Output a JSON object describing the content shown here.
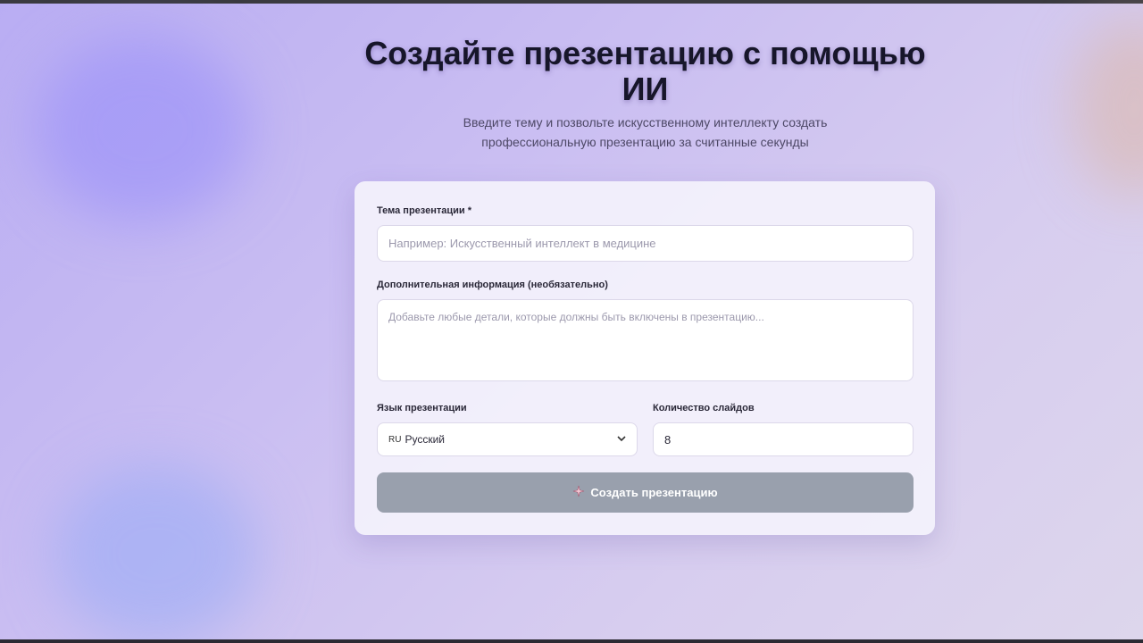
{
  "header": {
    "title": "Создайте презентацию с помощью ИИ",
    "subtitle": "Введите тему и позвольте искусственному интеллекту создать профессиональную презентацию за считанные секунды"
  },
  "form": {
    "topic": {
      "label": "Тема презентации *",
      "placeholder": "Например: Искусственный интеллект в медицине",
      "value": ""
    },
    "details": {
      "label": "Дополнительная информация (необязательно)",
      "placeholder": "Добавьте любые детали, которые должны быть включены в презентацию...",
      "value": ""
    },
    "language": {
      "label": "Язык презентации",
      "code": "RU",
      "value": "Русский",
      "icon": "chevron-down-icon"
    },
    "slides": {
      "label": "Количество слайдов",
      "value": "8"
    },
    "submit": {
      "label": "Создать презентацию",
      "icon": "sparkle-icon",
      "color": "#99a0ad"
    }
  }
}
